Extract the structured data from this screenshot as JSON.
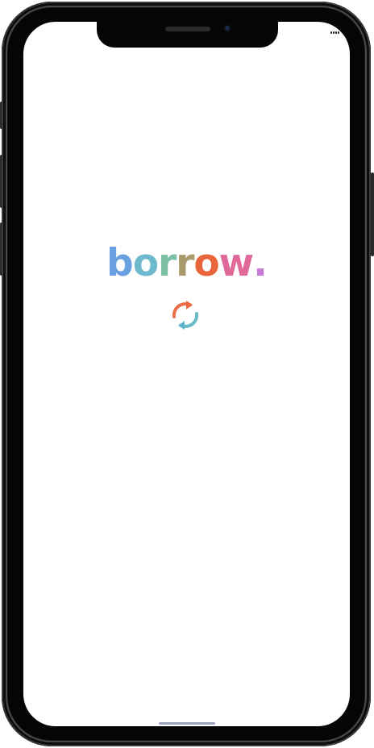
{
  "app": {
    "logo_text": "borrow.",
    "logo_letters": [
      {
        "char": "b",
        "color": "#6a9fe0"
      },
      {
        "char": "o",
        "color": "#6fb9cf"
      },
      {
        "char": "r",
        "color": "#7cc0a4"
      },
      {
        "char": "r",
        "color": "#a89a6a"
      },
      {
        "char": "o",
        "color": "#e9663c"
      },
      {
        "char": "w",
        "color": "#e0699a"
      },
      {
        "char": ".",
        "color": "#c87ad8"
      }
    ]
  },
  "loading": {
    "icon": "sync-icon",
    "colors": [
      "#f0663b",
      "#d8826a",
      "#7cc9b0",
      "#5fb3cf"
    ]
  },
  "colors": {
    "screen_background": "#ffffff",
    "device_frame": "#121212",
    "home_indicator": "#9aa6b8"
  }
}
